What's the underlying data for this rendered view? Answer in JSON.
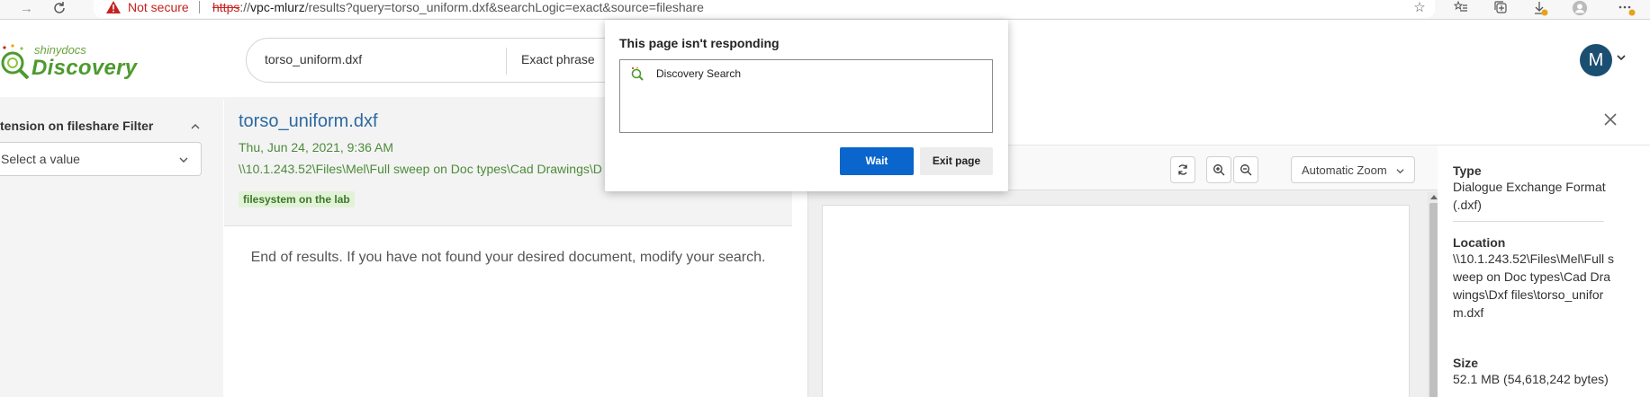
{
  "browser": {
    "security_label": "Not secure",
    "url_scheme": "https",
    "url_rest_prefix": "://",
    "url_host": "vpc-mlurz",
    "url_path": "/results?query=torso_uniform.dxf&searchLogic=exact&source=fileshare",
    "icons": [
      "back-arrow-icon",
      "refresh-icon",
      "warning-icon",
      "favorite-icon",
      "favorites-list-icon",
      "collections-icon",
      "downloads-icon",
      "profile-icon",
      "more-icon"
    ]
  },
  "app": {
    "logo_small": "shinydocs",
    "logo_big": "Discovery",
    "search": {
      "value": "torso_uniform.dxf",
      "logic": "Exact phrase"
    },
    "avatar_letter": "M",
    "accent_color": "#1b4f72"
  },
  "filter": {
    "title": "tension on fileshare Filter",
    "select_placeholder": "Select a value"
  },
  "result": {
    "title": "torso_uniform.dxf",
    "date": "Thu, Jun 24, 2021, 9:36 AM",
    "path": "\\\\10.1.243.52\\Files\\Mel\\Full sweep on Doc types\\Cad Drawings\\D",
    "tag": "filesystem on the lab",
    "end_message": "End of results. If you have not found your desired document, modify your search."
  },
  "viewer": {
    "zoom_label": "Automatic Zoom",
    "props": {
      "type_label": "Type",
      "type_value": "Dialogue Exchange Format (.dxf)",
      "location_label": "Location",
      "location_value": "\\\\10.1.243.52\\Files\\Mel\\Full sweep on Doc types\\Cad Drawings\\Dxf files\\torso_uniform.dxf",
      "size_label": "Size",
      "size_value": "52.1 MB (54,618,242 bytes)"
    }
  },
  "dialog": {
    "title": "This page isn't responding",
    "item": "Discovery Search",
    "wait_label": "Wait",
    "exit_label": "Exit page"
  }
}
